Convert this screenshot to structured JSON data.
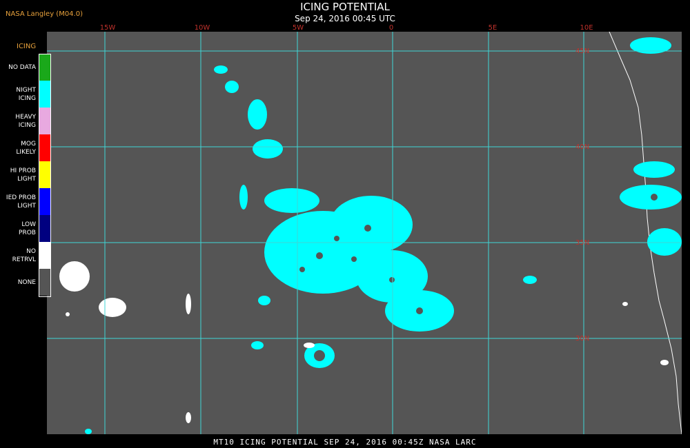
{
  "header": {
    "producer": "NASA Langley (M04.0)",
    "title": "ICING POTENTIAL",
    "subtitle": "Sep 24, 2016 00:45 UTC"
  },
  "longitude_labels": [
    "15W",
    "10W",
    "5W",
    "0",
    "5E",
    "10E"
  ],
  "latitude_labels": [
    "45N",
    "40N",
    "35N",
    "30N"
  ],
  "legend": {
    "title": "ICING",
    "items": [
      {
        "label_lines": [
          "NO DATA"
        ],
        "color": "#1aa81a"
      },
      {
        "label_lines": [
          "NIGHT",
          "ICING"
        ],
        "color": "#00ffff"
      },
      {
        "label_lines": [
          "HEAVY",
          "ICING"
        ],
        "color": "#e8a9e0"
      },
      {
        "label_lines": [
          "MOG",
          "LIKELY"
        ],
        "color": "#ff0000"
      },
      {
        "label_lines": [
          "HI PROB",
          "LIGHT"
        ],
        "color": "#ffff00"
      },
      {
        "label_lines": [
          "IED PROB",
          "LIGHT"
        ],
        "color": "#0000ff"
      },
      {
        "label_lines": [
          "LOW",
          "PROB"
        ],
        "color": "#000080"
      },
      {
        "label_lines": [
          "NO",
          "RETRVL"
        ],
        "color": "#ffffff"
      },
      {
        "label_lines": [
          "NONE"
        ],
        "color": "#555555"
      }
    ]
  },
  "colors": {
    "background": "#000000",
    "map_none": "#555555",
    "grid": "#3fd6d6",
    "label_red": "#c1322c",
    "producer_orange": "#e8a23c"
  },
  "bottom_caption": "MT10  ICING POTENTIAL  SEP 24, 2016 00:45Z  NASA LARC"
}
